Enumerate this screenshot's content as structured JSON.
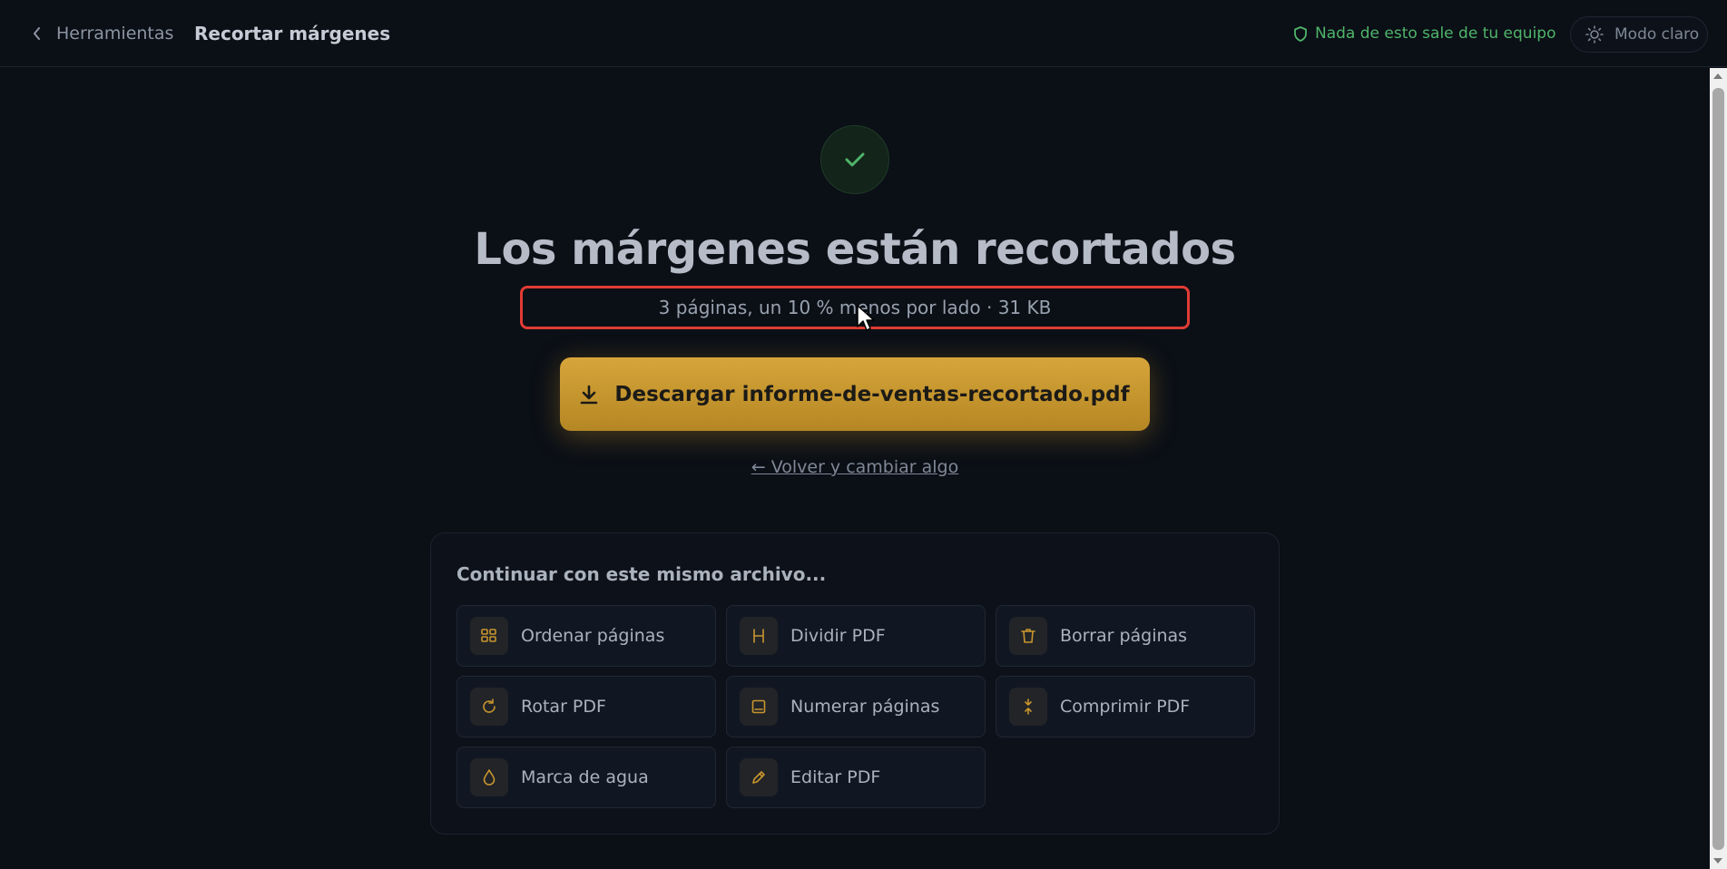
{
  "header": {
    "back_label": "Herramientas",
    "title": "Recortar márgenes",
    "privacy_note": "Nada de esto sale de tu equipo",
    "theme_label": "Modo claro"
  },
  "result": {
    "headline": "Los márgenes están recortados",
    "summary": "3 páginas, un 10 % menos por lado · 31 KB",
    "download_label": "Descargar informe-de-ventas-recortado.pdf",
    "back_link": "← Volver y cambiar algo"
  },
  "continue": {
    "title": "Continuar con este mismo archivo...",
    "tools": [
      {
        "label": "Ordenar páginas",
        "icon": "grid-icon"
      },
      {
        "label": "Dividir PDF",
        "icon": "split-icon"
      },
      {
        "label": "Borrar páginas",
        "icon": "trash-icon"
      },
      {
        "label": "Rotar PDF",
        "icon": "rotate-icon"
      },
      {
        "label": "Numerar páginas",
        "icon": "page-number-icon"
      },
      {
        "label": "Comprimir PDF",
        "icon": "compress-icon"
      },
      {
        "label": "Marca de agua",
        "icon": "droplet-icon"
      },
      {
        "label": "Editar PDF",
        "icon": "pencil-icon"
      }
    ]
  },
  "colors": {
    "accent": "#d7a53a",
    "success": "#4fb56a",
    "highlight": "#e03b34",
    "background": "#0b0f16"
  }
}
